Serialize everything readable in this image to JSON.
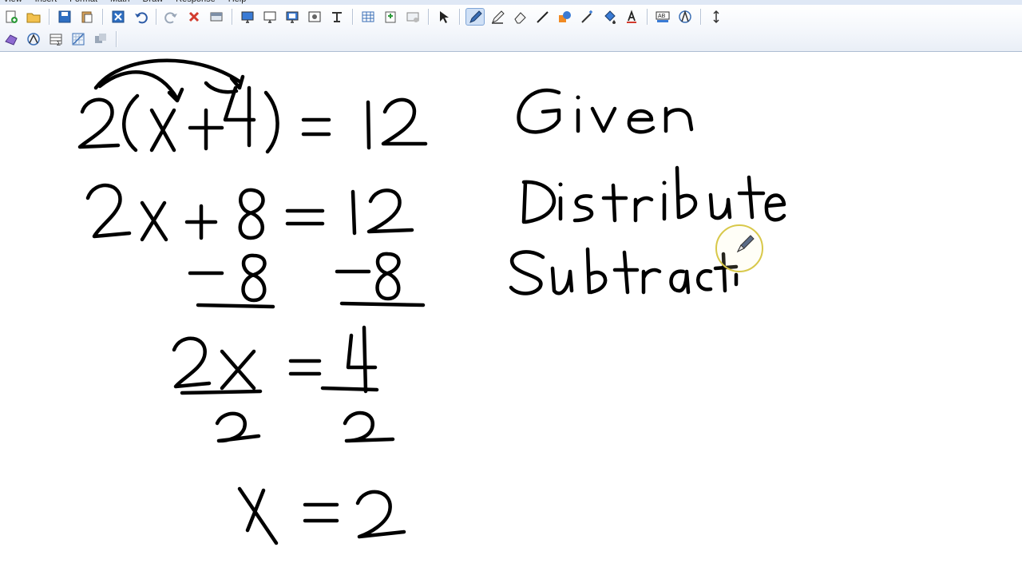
{
  "menu": {
    "items": [
      "View",
      "Insert",
      "Format",
      "Math",
      "Draw",
      "Response",
      "Help"
    ]
  },
  "toolbar": {
    "row1": [
      "new-page-icon",
      "open-icon",
      "save-icon",
      "paste-icon",
      "delete-page-icon",
      "undo-icon",
      "redo-icon",
      "delete-icon",
      "screen-shade-icon",
      "show-screen-icon",
      "screen-capture-icon",
      "display-icon",
      "image-icon",
      "text-tool-icon",
      "table-icon",
      "insert-page-icon",
      "screen-icon",
      "select-icon",
      "pen-icon",
      "highlighter-icon",
      "eraser-icon",
      "line-icon",
      "shapes-icon",
      "magic-wand-icon",
      "fill-icon",
      "text-color-icon",
      "text-format-icon",
      "compass-icon",
      "resize-icon"
    ],
    "row2": [
      "shape-recognizer-icon",
      "geometry-icon",
      "table-sum-icon",
      "graph-icon",
      "gallery-icon"
    ],
    "active_tool": "pen-icon"
  },
  "colors": {
    "toolbar_bg": "#f3f6fb",
    "ink": "#000000",
    "cursor_ring": "#d8c84a"
  },
  "notes": {
    "lines": [
      "2(x+4) = 12",
      "2x + 8 = 12",
      "-8   -8",
      "2x/2 = 4/2",
      "x = 2"
    ],
    "labels": [
      "Given",
      "Distribute",
      "Subtracti"
    ]
  }
}
